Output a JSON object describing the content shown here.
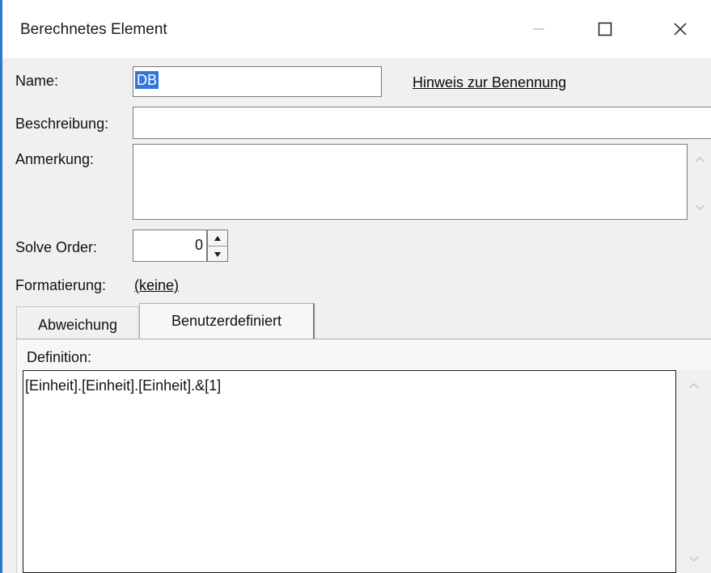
{
  "window": {
    "title": "Berechnetes Element",
    "controls": {
      "minimize": "minimize-icon",
      "maximize": "maximize-icon",
      "close": "close-icon"
    }
  },
  "form": {
    "name_label": "Name:",
    "name_value": "DB",
    "naming_hint_link": "Hinweis zur Benennung",
    "description_label": "Beschreibung:",
    "description_value": "",
    "note_label": "Anmerkung:",
    "note_value": "",
    "solve_order_label": "Solve Order:",
    "solve_order_value": "0",
    "formatting_label": "Formatierung:",
    "formatting_link": "(keine)"
  },
  "tabs": [
    {
      "label": "Abweichung",
      "active": false
    },
    {
      "label": "Benutzerdefiniert",
      "active": true
    }
  ],
  "definition": {
    "label": "Definition:",
    "value": "[Einheit].[Einheit].[Einheit].&[1]"
  },
  "colors": {
    "accent_border": "#2b79d0",
    "selection": "#3377dd",
    "dialog_background": "#f0f0f0"
  }
}
